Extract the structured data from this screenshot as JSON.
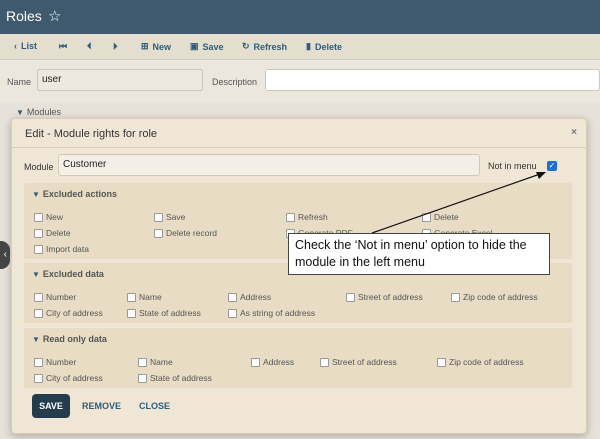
{
  "window": {
    "title": "Roles"
  },
  "toolbar": {
    "list": "List",
    "new": "New",
    "save": "Save",
    "refresh": "Refresh",
    "delete": "Delete"
  },
  "form": {
    "name_label": "Name",
    "name_value": "user",
    "description_label": "Description",
    "description_value": "",
    "modules_label": "Modules"
  },
  "dialog": {
    "title": "Edit - Module rights for role",
    "module_label": "Module",
    "module_value": "Customer",
    "not_in_menu_label": "Not in menu",
    "not_in_menu_checked": true,
    "sections": {
      "excluded_actions": {
        "title": "Excluded actions",
        "items": [
          "New",
          "Save",
          "Refresh",
          "Delete",
          "Delete",
          "Delete record",
          "Generate PDF",
          "Generate Excel",
          "Import data"
        ]
      },
      "excluded_data": {
        "title": "Excluded data",
        "items": [
          "Number",
          "Name",
          "Address",
          "Street of address",
          "Zip code of address",
          "City of address",
          "State of address",
          "As string of address"
        ]
      },
      "read_only_data": {
        "title": "Read only data",
        "items": [
          "Number",
          "Name",
          "Address",
          "Street of address",
          "Zip code of address",
          "City of address",
          "State of address"
        ]
      }
    },
    "buttons": {
      "save": "SAVE",
      "remove": "REMOVE",
      "close": "CLOSE"
    }
  },
  "callout": {
    "text": "Check the ‘Not in menu’ option to hide the module in the left menu"
  }
}
